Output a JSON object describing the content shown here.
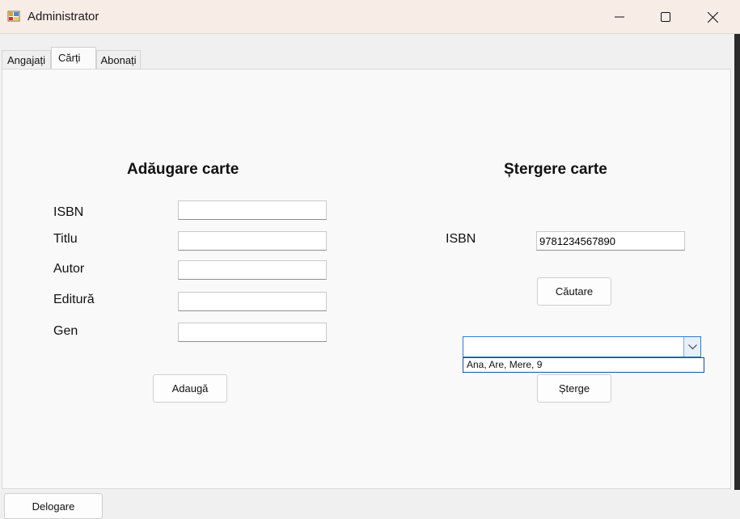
{
  "window": {
    "title": "Administrator",
    "icon": "app-form-icon",
    "controls": {
      "minimize": "minimize-icon",
      "maximize": "maximize-icon",
      "close": "close-icon"
    }
  },
  "tabs": [
    {
      "label": "Angajați",
      "active": false
    },
    {
      "label": "Cărți",
      "active": true
    },
    {
      "label": "Abonați",
      "active": false
    }
  ],
  "add_book": {
    "heading": "Adăugare carte",
    "fields": [
      {
        "label": "ISBN",
        "value": ""
      },
      {
        "label": "Titlu",
        "value": ""
      },
      {
        "label": "Autor",
        "value": ""
      },
      {
        "label": "Editură",
        "value": ""
      },
      {
        "label": "Gen",
        "value": ""
      }
    ],
    "submit_label": "Adaugă"
  },
  "delete_book": {
    "heading": "Ștergere carte",
    "isbn_label": "ISBN",
    "isbn_value": "9781234567890",
    "search_label": "Căutare",
    "combo_value": "",
    "dropdown_items": [
      "Ana, Are, Mere, 9"
    ],
    "delete_label": "Șterge"
  },
  "footer": {
    "logout_label": "Delogare"
  }
}
